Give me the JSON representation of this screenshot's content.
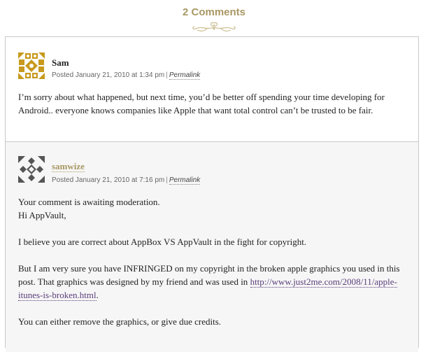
{
  "header": {
    "title": "2 Comments"
  },
  "comments": [
    {
      "author": "Sam",
      "posted": "Posted January 21, 2010 at 1:34 pm",
      "permalink": "Permalink",
      "text": "I’m sorry about what happened, but next time, you’d be better off spending your time developing for Android.. everyone knows companies like Apple that want total control can’t be trusted to be fair."
    },
    {
      "author": "samwize",
      "posted": "Posted January 21, 2010 at 7:16 pm",
      "permalink": "Permalink",
      "moderation": "Your comment is awaiting moderation.",
      "greeting": "Hi AppVault,",
      "para1": "I believe you are correct about AppBox VS AppVault in the fight for copyright.",
      "para2_before": "But I am very sure you have INFRINGED on my copyright in the broken apple graphics you used in this post. That graphics was designed by my friend and was used in",
      "para2_link": "http://www.just2me.com/2008/11/apple-itunes-is-broken.html",
      "para2_after": ".",
      "para3": "You can either remove the graphics, or give due credits."
    }
  ],
  "colors": {
    "accent": "#a99864",
    "link": "#5a3d7a",
    "border": "#c8c8c8"
  }
}
